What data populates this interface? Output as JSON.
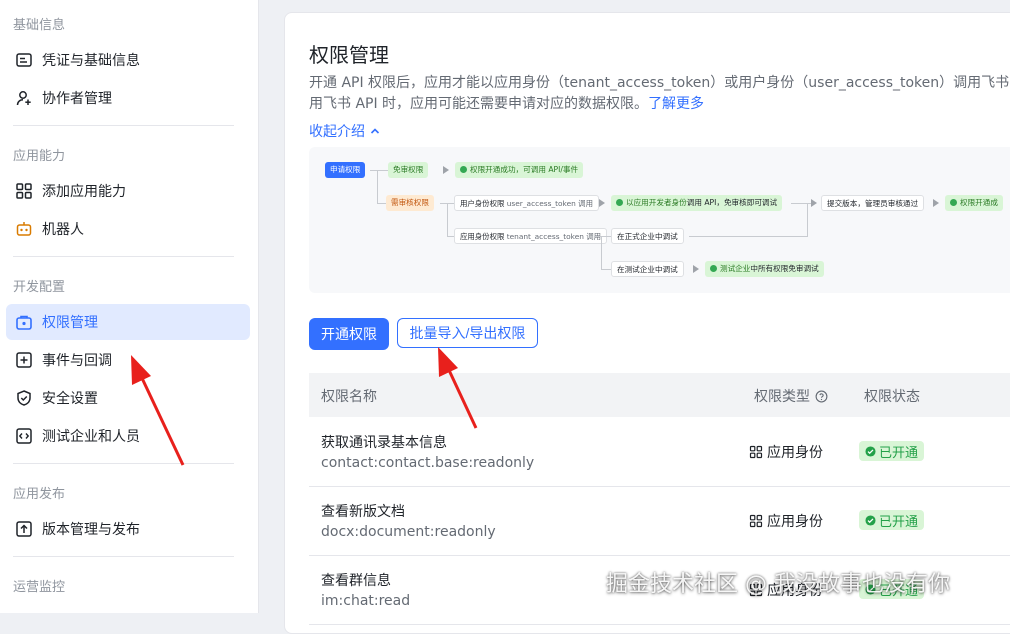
{
  "sidebar": {
    "sections": [
      {
        "title": "基础信息",
        "items": [
          "凭证与基础信息",
          "协作者管理"
        ]
      },
      {
        "title": "应用能力",
        "items": [
          "添加应用能力",
          "机器人"
        ]
      },
      {
        "title": "开发配置",
        "items": [
          "权限管理",
          "事件与回调",
          "安全设置",
          "测试企业和人员"
        ]
      },
      {
        "title": "应用发布",
        "items": [
          "版本管理与发布"
        ]
      },
      {
        "title": "运营监控",
        "items": []
      }
    ],
    "active_item": "权限管理"
  },
  "main": {
    "title": "权限管理",
    "desc_line1": "开通 API 权限后，应用才能以应用身份（tenant_access_token）或用户身份（user_access_token）调用飞书 API；",
    "desc_line2": "用飞书 API 时，应用可能还需要申请对应的数据权限。",
    "learn_more": "了解更多",
    "collapse": "收起介绍",
    "flow": {
      "apply": "申请权限",
      "no_review": "免审权限",
      "no_review_result": "权限开通成功，可调用 API/事件",
      "need_review": "需审核权限",
      "user_identity": "用户身份权限",
      "user_token": "user_access_token",
      "call": "调用",
      "user_result_a": "以应用开发者身份",
      "user_result_b": "调用 API，免审核即可调试",
      "submit": "提交版本，管理员审核通过",
      "final": "权限开通成",
      "app_identity": "应用身份权限",
      "tenant_token": "tenant_access_token",
      "formal": "在正式企业中调试",
      "test": "在测试企业中调试",
      "test_result_a": "测试企业",
      "test_result_b": "中所有权限免审调试"
    },
    "buttons": {
      "enable": "开通权限",
      "batch": "批量导入/导出权限"
    },
    "table": {
      "headers": {
        "name": "权限名称",
        "type": "权限类型",
        "status": "权限状态"
      },
      "rows": [
        {
          "name": "获取通讯录基本信息",
          "code": "contact:contact.base:readonly",
          "type": "应用身份",
          "status": "已开通"
        },
        {
          "name": "查看新版文档",
          "code": "docx:document:readonly",
          "type": "应用身份",
          "status": "已开通"
        },
        {
          "name": "查看群信息",
          "code": "im:chat:read",
          "type": "应用身份",
          "status": "已开通"
        }
      ]
    }
  },
  "watermark": "掘金技术社区 @ 我没故事也没有你",
  "colors": {
    "accent": "#3370ff",
    "success": "#24a149",
    "annotation_arrow": "#e8201c"
  },
  "icons": [
    "credential-icon",
    "collaborator-icon",
    "capability-icon",
    "robot-icon",
    "permission-icon",
    "event-icon",
    "security-icon",
    "test-org-icon",
    "version-icon",
    "chevron-up-icon",
    "help-icon",
    "app-identity-icon",
    "check-icon"
  ]
}
